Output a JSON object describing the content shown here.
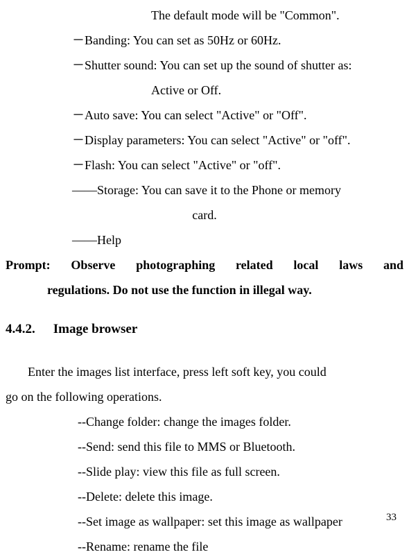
{
  "lines": {
    "default_mode": "The default mode will be \"Common\".",
    "banding": "－Banding: You can set as 50Hz or 60Hz.",
    "shutter": "－Shutter sound: You can set up the sound of shutter as:",
    "shutter_cont": "Active or Off.",
    "autosave": "－Auto save: You can select \"Active\" or \"Off\".",
    "display_params": "－Display parameters: You can select \"Active\" or \"off\".",
    "flash": "－Flash: You can select \"Active\" or \"off\".",
    "storage": "――Storage: You can save it to the Phone or memory",
    "storage_cont": "card.",
    "help": "――Help"
  },
  "prompt": {
    "line1": "Prompt: Observe photographing related local laws and",
    "line2": "regulations. Do not use the function in illegal way."
  },
  "section": {
    "num": "4.4.2.",
    "title": "Image browser"
  },
  "body": {
    "p1": "Enter the images list interface, press left soft key, you could",
    "p2": "go on the following operations."
  },
  "ops": {
    "change_folder": "--Change folder: change the images folder.",
    "send": "--Send: send this file to MMS or Bluetooth.",
    "slide": "--Slide play: view this file as full screen.",
    "delete": "--Delete: delete this image.",
    "wallpaper": "--Set image as wallpaper: set this image as wallpaper",
    "rename": "--Rename: rename the file"
  },
  "page_num": "33"
}
